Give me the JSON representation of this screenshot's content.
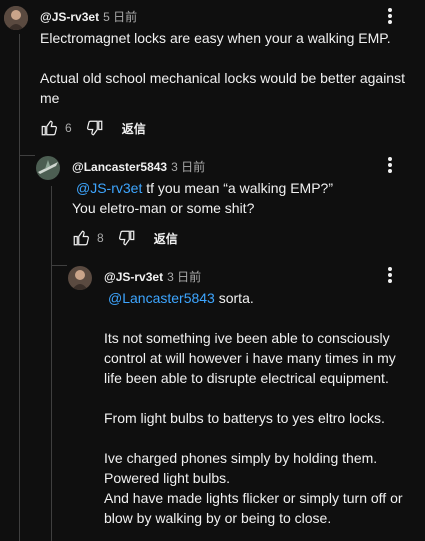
{
  "comments": [
    {
      "author": "@JS-rv3et",
      "time": "5 日前",
      "lines": [
        "Electromagnet locks are easy when your a walking EMP.",
        "",
        "Actual old school mechanical locks would be better against",
        "me"
      ],
      "likes": "6",
      "reply_label": "返信"
    },
    {
      "author": "@Lancaster5843",
      "time": "3 日前",
      "mention": "@JS-rv3et",
      "line1_rest": " tf you mean “a walking EMP?”",
      "line2": "You eletro-man or some shit?",
      "likes": "8",
      "reply_label": "返信"
    },
    {
      "author": "@JS-rv3et",
      "time": "3 日前",
      "mention": "@Lancaster5843",
      "line1_rest": " sorta.",
      "lines": [
        "",
        "Its not something ive been able to consciously",
        "control at will however i have many times in my",
        "life been able to disrupte electrical equipment.",
        "",
        "From light bulbs to batterys to yes eltro locks.",
        "",
        "Ive charged phones simply by holding them.",
        "Powered light bulbs.",
        "And have made lights flicker or simply turn off or",
        "blow by walking by or being to close."
      ]
    }
  ]
}
